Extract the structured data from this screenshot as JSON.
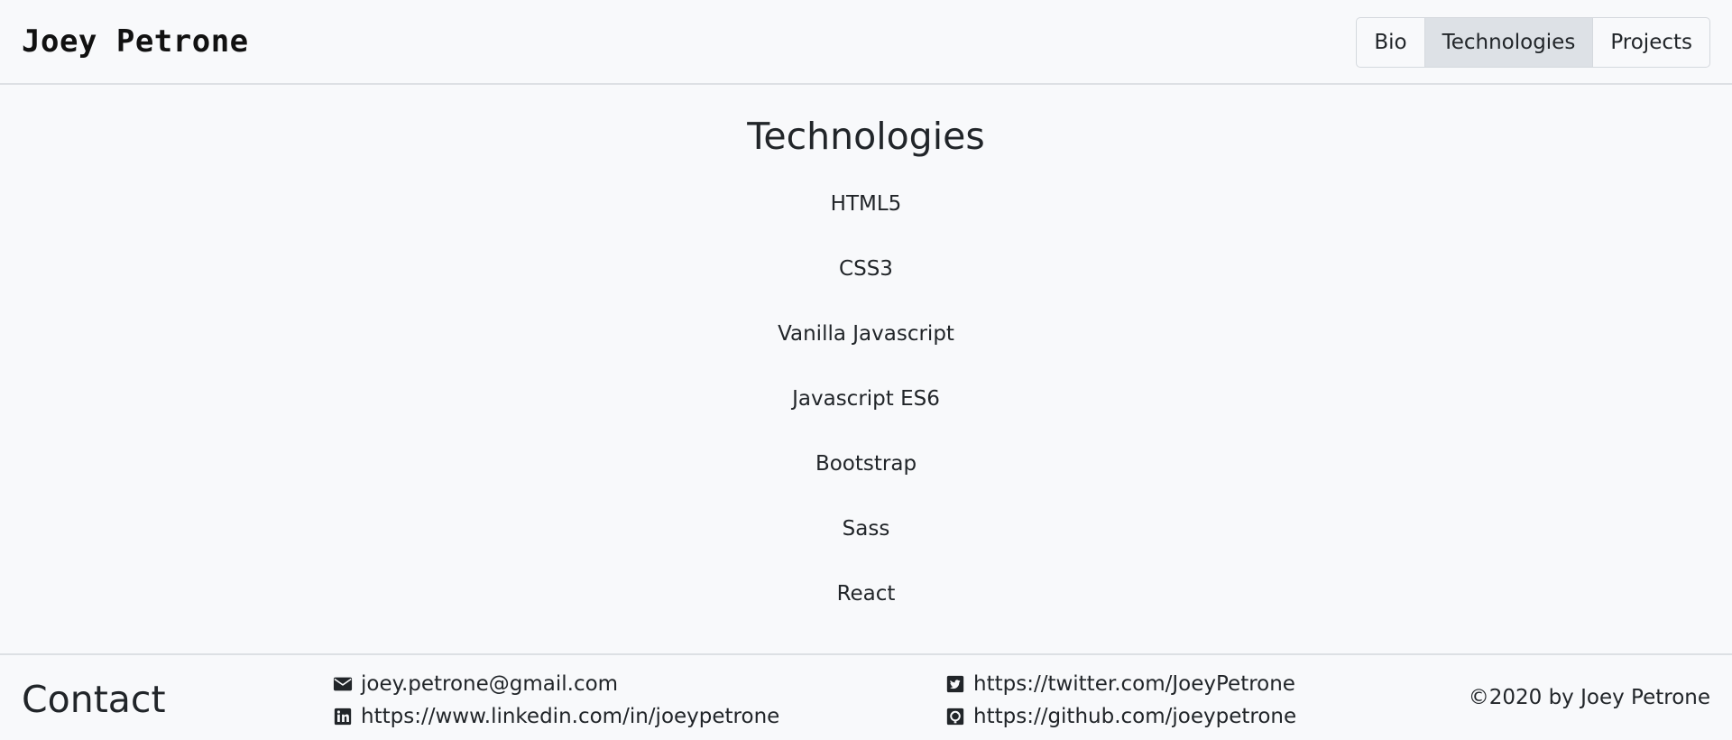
{
  "header": {
    "brand": "Joey Petrone",
    "nav": [
      {
        "label": "Bio",
        "active": false
      },
      {
        "label": "Technologies",
        "active": true
      },
      {
        "label": "Projects",
        "active": false
      }
    ]
  },
  "main": {
    "title": "Technologies",
    "technologies": [
      "HTML5",
      "CSS3",
      "Vanilla Javascript",
      "Javascript ES6",
      "Bootstrap",
      "Sass",
      "React"
    ]
  },
  "footer": {
    "title": "Contact",
    "email": {
      "icon": "envelope-icon",
      "text": "joey.petrone@gmail.com"
    },
    "linkedin": {
      "icon": "linkedin-icon",
      "text": "https://www.linkedin.com/in/joeypetrone"
    },
    "twitter": {
      "icon": "twitter-icon",
      "text": "https://twitter.com/JoeyPetrone"
    },
    "github": {
      "icon": "github-icon",
      "text": "https://github.com/joeypetrone"
    },
    "copyright": "©2020 by Joey Petrone"
  },
  "colors": {
    "background": "#f8f9fb",
    "text": "#212529",
    "border": "#dde0e4",
    "nav_active": "#dde1e6"
  }
}
